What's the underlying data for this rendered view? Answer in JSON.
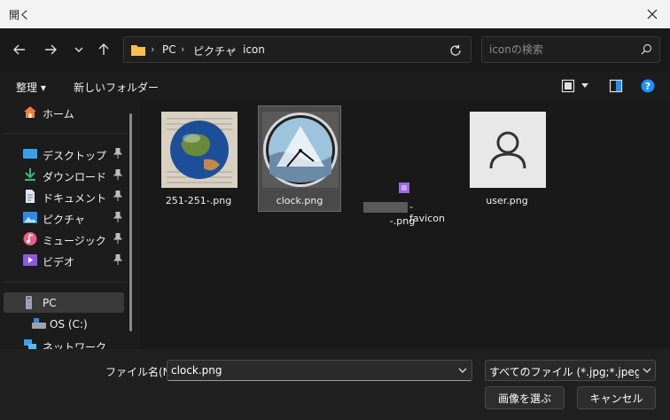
{
  "window": {
    "title": "開く"
  },
  "address": {
    "crumbs": [
      "PC",
      "ピクチャ",
      "icon"
    ]
  },
  "search": {
    "placeholder": "iconの検索"
  },
  "toolbar": {
    "organize": "整理 ▾",
    "new_folder": "新しいフォルダー"
  },
  "sidebar": {
    "items": [
      {
        "label": "ホーム",
        "icon": "home-icon"
      },
      {
        "label": "デスクトップ",
        "icon": "desktop-icon",
        "pinned": true
      },
      {
        "label": "ダウンロード",
        "icon": "download-icon",
        "pinned": true
      },
      {
        "label": "ドキュメント",
        "icon": "document-icon",
        "pinned": true
      },
      {
        "label": "ピクチャ",
        "icon": "pictures-icon",
        "pinned": true
      },
      {
        "label": "ミュージック",
        "icon": "music-icon",
        "pinned": true
      },
      {
        "label": "ビデオ",
        "icon": "video-icon",
        "pinned": true
      },
      {
        "label": "PC",
        "icon": "pc-icon",
        "selected": true
      },
      {
        "label": "OS (C:)",
        "icon": "drive-icon"
      },
      {
        "label": "ネットワーク",
        "icon": "network-icon"
      }
    ]
  },
  "files": [
    {
      "name": "251-251-.png",
      "thumb": "globe-thumb"
    },
    {
      "name": "clock.png",
      "thumb": "clock-thumb",
      "selected": true
    },
    {
      "name_line1": "-favicon",
      "name_line2": "-.png",
      "thumb": "favicon-thumb"
    },
    {
      "name": "user.png",
      "thumb": "user-thumb"
    }
  ],
  "footer": {
    "filename_label": "ファイル名(N):",
    "filename_value": "clock.png",
    "filetype_value": "すべてのファイル (*.jpg;*.jpeg;*.bmp",
    "open_button": "画像を選ぶ",
    "cancel_button": "キャンセル"
  },
  "colors": {
    "accent": "#1e90ff",
    "folder": "#f7c04a",
    "selected_bg": "#4a4a4a"
  }
}
